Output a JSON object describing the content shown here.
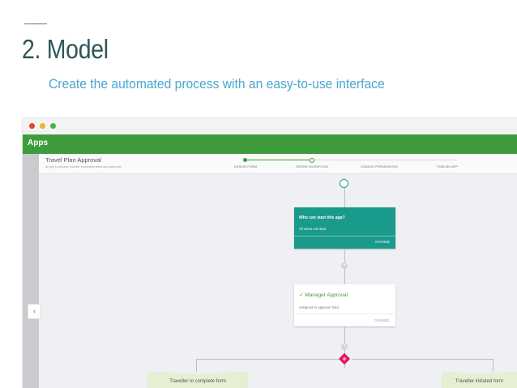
{
  "slide": {
    "title": "2. Model",
    "subtitle": "Create the automated process with an easy-to-use interface"
  },
  "window": {
    "app_title": "Apps",
    "process": {
      "name": "Travel Plan Approval",
      "description": "An app to process Traveller Employees travel and approvals"
    },
    "stepper": [
      {
        "label": "DESIGN FORM",
        "state": "done"
      },
      {
        "label": "DEFINE WORKFLOW",
        "state": "current"
      },
      {
        "label": "CHANGE PERMISSIONS",
        "state": "pending"
      },
      {
        "label": "PUBLISH APP",
        "state": "pending"
      }
    ],
    "colors": {
      "app_bar": "#3e9c3d",
      "start_card": "#199a8a",
      "gateway": "#e6125f",
      "branch": "#e4efd3"
    },
    "start_card": {
      "title": "Who can start this app?",
      "subtitle": "All users can start",
      "action": "CHANGE"
    },
    "approval_card": {
      "title": "✓ Manager Approval",
      "subtitle": "Assigned to Approver field",
      "action": "CHANGE"
    },
    "branches": [
      {
        "label": "Traveller to complete form"
      },
      {
        "label": "Traveller initiated form"
      }
    ],
    "back_icon": "chevron-left-icon",
    "gateway_icon": "plus-icon"
  }
}
